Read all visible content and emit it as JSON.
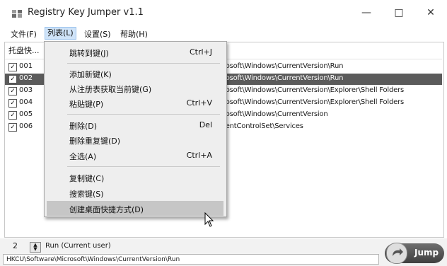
{
  "window": {
    "title": "Registry Key Jumper v1.1",
    "controls": {
      "minimize": "—",
      "maximize": "□",
      "close": "✕"
    }
  },
  "menubar": {
    "items": [
      {
        "label": "文件(F)"
      },
      {
        "label": "列表(L)"
      },
      {
        "label": "设置(S)"
      },
      {
        "label": "帮助(H)"
      }
    ]
  },
  "list": {
    "column_header": "托盘快...",
    "rows": [
      {
        "id": "001",
        "checked": true,
        "path": "rosoft\\Windows\\CurrentVersion\\Run"
      },
      {
        "id": "002",
        "checked": true,
        "path": "rosoft\\Windows\\CurrentVersion\\Run",
        "selected": true
      },
      {
        "id": "003",
        "checked": true,
        "path": "rosoft\\Windows\\CurrentVersion\\Explorer\\Shell Folders"
      },
      {
        "id": "004",
        "checked": true,
        "path": "rosoft\\Windows\\CurrentVersion\\Explorer\\Shell Folders"
      },
      {
        "id": "005",
        "checked": true,
        "path": "rosoft\\Windows\\CurrentVersion"
      },
      {
        "id": "006",
        "checked": true,
        "path": "rentControlSet\\Services"
      }
    ]
  },
  "dropdown": {
    "items": [
      {
        "label": "跳转到键(J)",
        "shortcut": "Ctrl+J"
      },
      {
        "label": "添加新键(K)",
        "shortcut": ""
      },
      {
        "label": "从注册表获取当前键(G)",
        "shortcut": ""
      },
      {
        "label": "粘贴键(P)",
        "shortcut": "Ctrl+V"
      },
      {
        "label": "删除(D)",
        "shortcut": "Del"
      },
      {
        "label": "删除重复键(D)",
        "shortcut": ""
      },
      {
        "label": "全选(A)",
        "shortcut": "Ctrl+A"
      },
      {
        "label": "复制键(C)",
        "shortcut": ""
      },
      {
        "label": "搜索键(S)",
        "shortcut": ""
      },
      {
        "label": "创建桌面快捷方式(D)",
        "shortcut": "",
        "hover": true
      }
    ]
  },
  "status": {
    "spinner_value": "2",
    "mode_label": "Run (Current user)",
    "path": "HKCU\\Software\\Microsoft\\Windows\\CurrentVersion\\Run",
    "jump_label": "Jump"
  }
}
